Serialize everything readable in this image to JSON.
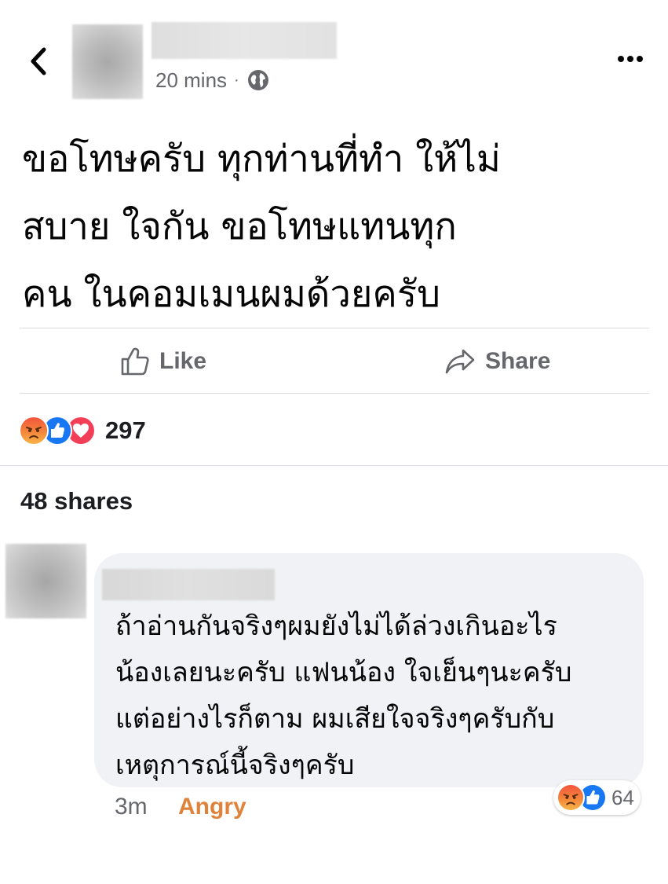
{
  "post": {
    "timestamp": "20 mins",
    "separator": "·",
    "privacy_icon": "globe-icon",
    "text": "ขอโทษครับ ทุกท่านที่ทำ ให้ไม่\nสบาย ใจกัน ขอโทษแทนทุก\nคน ในคอมเมนผมด้วยครับ"
  },
  "actions": {
    "like_label": "Like",
    "share_label": "Share"
  },
  "reactions": {
    "icons": [
      "angry-react-icon",
      "like-react-icon",
      "love-react-icon"
    ],
    "count": "297"
  },
  "shares_label": "48 shares",
  "comment": {
    "text": "ถ้าอ่านกันจริงๆผมยังไม่ได้ล่วงเกินอะไร\nน้องเลยนะครับ แฟนน้อง ใจเย็นๆนะครับ\nแต่อย่างไรก็ตาม ผมเสียใจจริงๆครับกับ\nเหตุการณ์นี้จริงๆครับ",
    "time": "3m",
    "user_reaction": "Angry",
    "reaction_icons": [
      "angry-react-icon",
      "like-react-icon"
    ],
    "reaction_count": "64"
  },
  "colors": {
    "meta_gray": "#65676b",
    "bubble_bg": "#f0f2f5",
    "angry_orange": "#e0833a",
    "like_blue": "#1877f2",
    "love_red": "#f33e58"
  }
}
